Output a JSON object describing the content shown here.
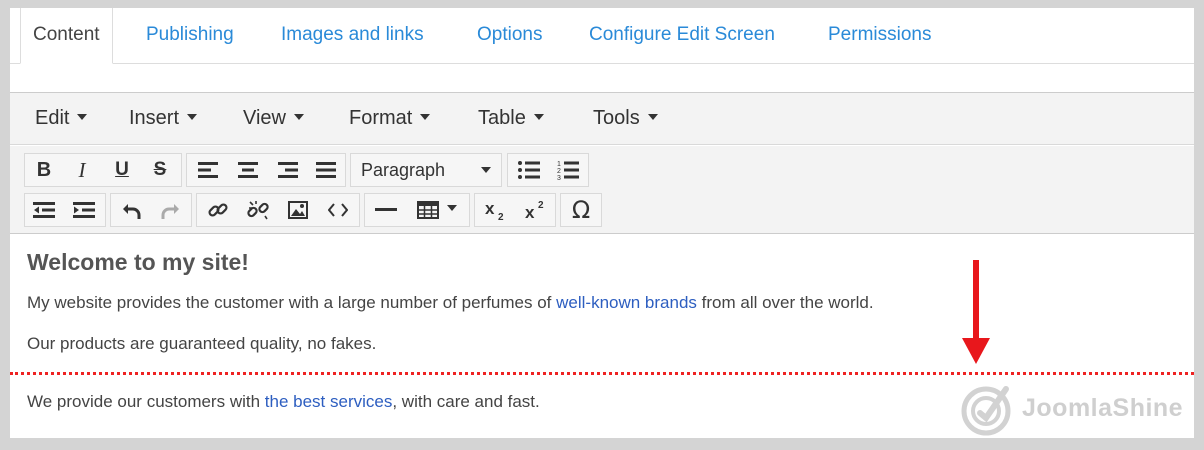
{
  "tabs": [
    {
      "label": "Content",
      "active": true
    },
    {
      "label": "Publishing"
    },
    {
      "label": "Images and links"
    },
    {
      "label": "Options"
    },
    {
      "label": "Configure Edit Screen"
    },
    {
      "label": "Permissions"
    }
  ],
  "menubar": {
    "items": [
      "Edit",
      "Insert",
      "View",
      "Format",
      "Table",
      "Tools"
    ]
  },
  "toolbar": {
    "bold_label": "B",
    "italic_label": "I",
    "underline_label": "U",
    "strike_label": "S",
    "format_select": "Paragraph",
    "special_char_label": "Ω",
    "icons": [
      "bold-icon",
      "italic-icon",
      "underline-icon",
      "strikethrough-icon",
      "align-left-icon",
      "align-center-icon",
      "align-right-icon",
      "align-justify-icon",
      "bullet-list-icon",
      "numbered-list-icon",
      "outdent-icon",
      "indent-icon",
      "undo-icon",
      "redo-icon",
      "link-icon",
      "unlink-icon",
      "image-icon",
      "code-icon",
      "horizontal-rule-icon",
      "table-icon",
      "subscript-icon",
      "superscript-icon",
      "omega-icon"
    ]
  },
  "content": {
    "heading": "Welcome to my site!",
    "p1_before": "My website provides the customer with a large number of perfumes of ",
    "p1_link": "well-known brands",
    "p1_after": " from all over the world.",
    "p2": "Our products are guaranteed quality, no fakes.",
    "p3_before": "We provide our customers with ",
    "p3_link": "the best services",
    "p3_after": ", with care and fast."
  },
  "watermark": {
    "text": "JoomlaShine"
  },
  "colors": {
    "link": "#2d5ec0",
    "tab_link": "#2a8ad8",
    "page_break": "#ee2222",
    "arrow": "#e8171c"
  }
}
